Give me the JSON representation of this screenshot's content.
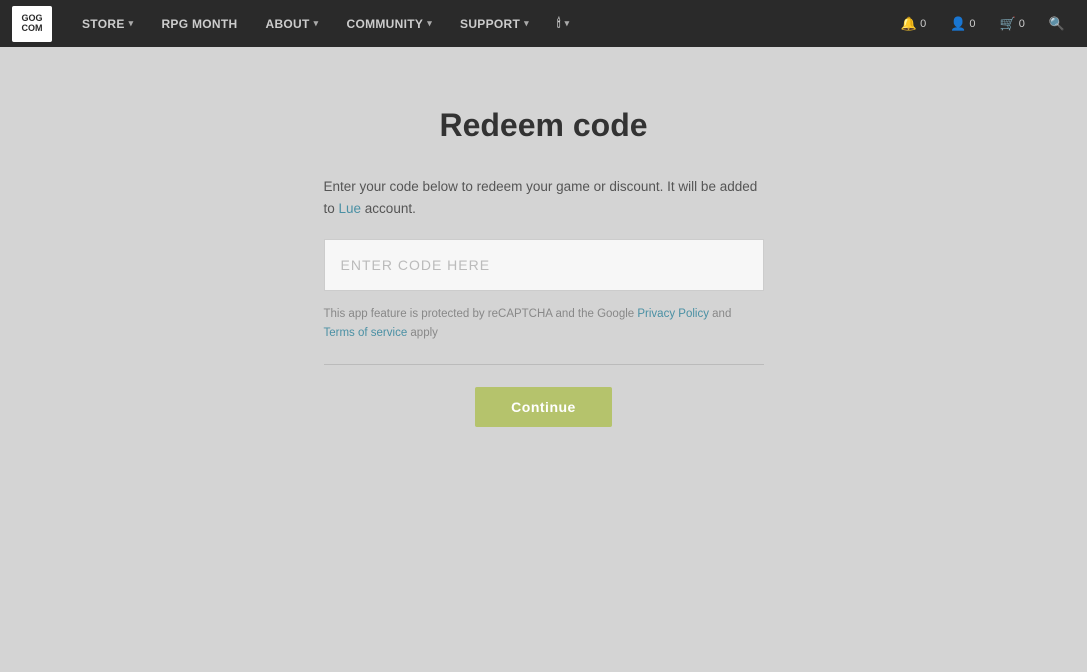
{
  "navbar": {
    "logo_line1": "GOG",
    "logo_line2": "COM",
    "links": [
      {
        "label": "STORE",
        "has_dropdown": true
      },
      {
        "label": "RPG MONTH",
        "has_dropdown": false
      },
      {
        "label": "ABOUT",
        "has_dropdown": true
      },
      {
        "label": "COMMUNITY",
        "has_dropdown": true
      },
      {
        "label": "SUPPORT",
        "has_dropdown": true
      }
    ],
    "extra_icon_label": "▾",
    "notifications_count": "0",
    "account_count": "0",
    "cart_count": "0"
  },
  "page": {
    "title": "Redeem code",
    "description_part1": "Enter your code below to redeem your game or discount. It will be added to ",
    "description_username": "Lue",
    "description_part2": " account.",
    "code_input_placeholder": "ENTER CODE HERE",
    "recaptcha_text_prefix": "This app feature is protected by reCAPTCHA and the Google ",
    "recaptcha_privacy_link": "Privacy Policy",
    "recaptcha_and": " and ",
    "recaptcha_terms_link": "Terms of service",
    "recaptcha_suffix": " apply",
    "continue_button_label": "Continue"
  }
}
